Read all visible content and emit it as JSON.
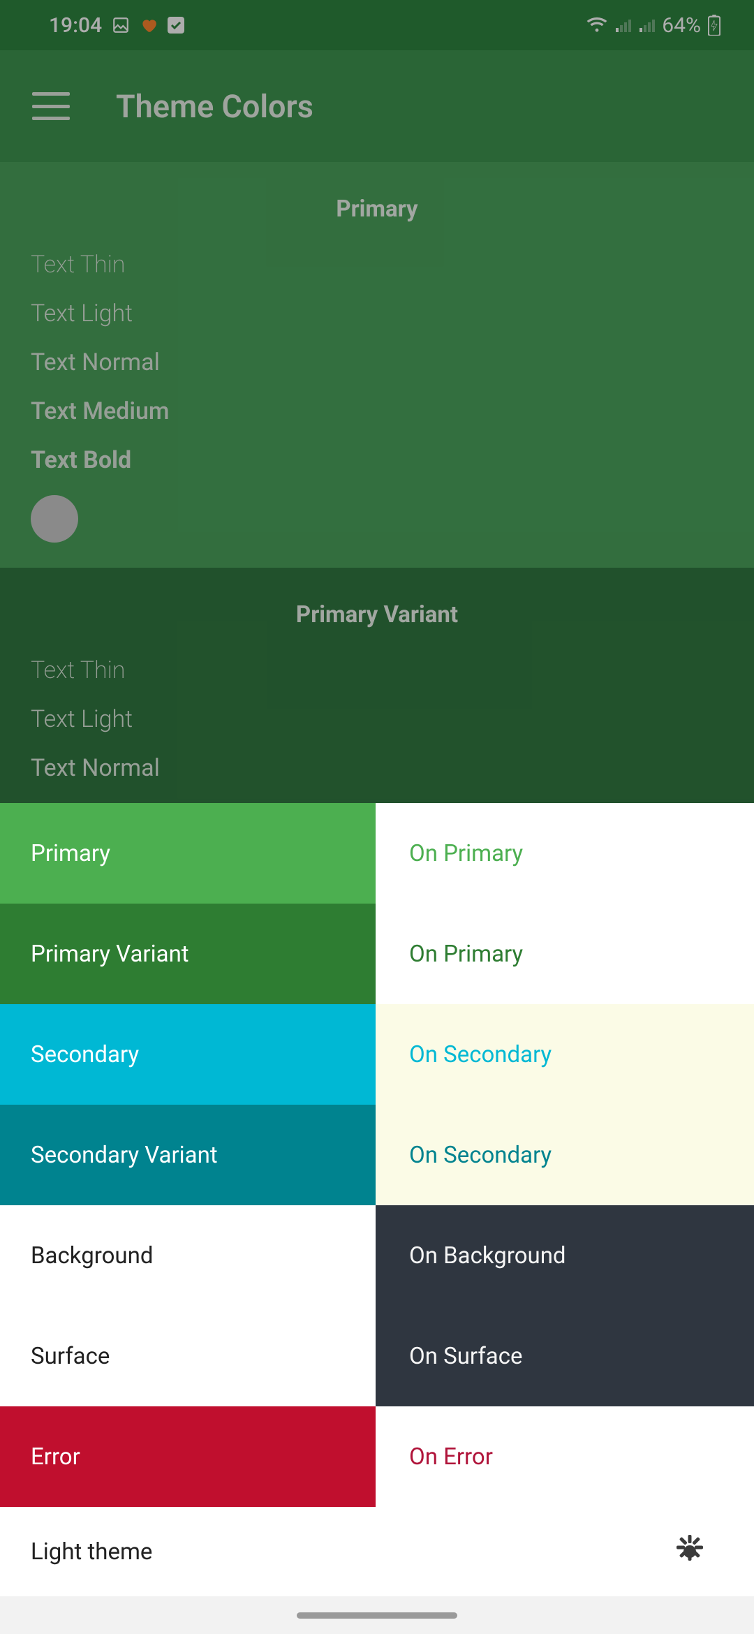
{
  "status": {
    "time": "19:04",
    "battery": "64%"
  },
  "appbar": {
    "title": "Theme Colors"
  },
  "swatches": {
    "primary": {
      "title": "Primary",
      "samples": [
        "Text Thin",
        "Text Light",
        "Text Normal",
        "Text Medium",
        "Text Bold"
      ]
    },
    "primary_variant": {
      "title": "Primary Variant",
      "samples": [
        "Text Thin",
        "Text Light",
        "Text Normal"
      ]
    }
  },
  "palette": [
    {
      "left_label": "Primary",
      "left_bg": "#4CAF50",
      "left_fg": "#FFFFFF",
      "right_label": "On Primary",
      "right_bg": "#FFFFFF",
      "right_fg": "#4CAF50"
    },
    {
      "left_label": "Primary Variant",
      "left_bg": "#2E7D32",
      "left_fg": "#FFFFFF",
      "right_label": "On Primary",
      "right_bg": "#FFFFFF",
      "right_fg": "#2E7D32"
    },
    {
      "left_label": "Secondary",
      "left_bg": "#00B8D4",
      "left_fg": "#FFFFFF",
      "right_label": "On Secondary",
      "right_bg": "#FBFBE6",
      "right_fg": "#00B8D4"
    },
    {
      "left_label": "Secondary Variant",
      "left_bg": "#00838F",
      "left_fg": "#FFFFFF",
      "right_label": "On Secondary",
      "right_bg": "#FBFBE6",
      "right_fg": "#00838F"
    },
    {
      "left_label": "Background",
      "left_bg": "#FFFFFF",
      "left_fg": "#212121",
      "right_label": "On Background",
      "right_bg": "#2F3640",
      "right_fg": "#F5F5F5"
    },
    {
      "left_label": "Surface",
      "left_bg": "#FFFFFF",
      "left_fg": "#212121",
      "right_label": "On Surface",
      "right_bg": "#2F3640",
      "right_fg": "#F5F5F5"
    },
    {
      "left_label": "Error",
      "left_bg": "#C2185B",
      "left_fg": "#FFFFFF",
      "right_label": "On Error",
      "right_bg": "#FFFFFF",
      "right_fg": "#C2185B"
    }
  ],
  "palette_colors_adjusted": [
    {
      "left_bg": "#4CAF50"
    },
    {
      "left_bg": "#2E7D32"
    },
    {
      "left_bg": "#00B8D4"
    },
    {
      "left_bg": "#00838F"
    },
    {
      "left_bg": "#FFFFFF"
    },
    {
      "left_bg": "#FFFFFF"
    },
    {
      "left_bg": "#C00F2E"
    }
  ],
  "theme_toggle": {
    "label": "Light theme"
  }
}
